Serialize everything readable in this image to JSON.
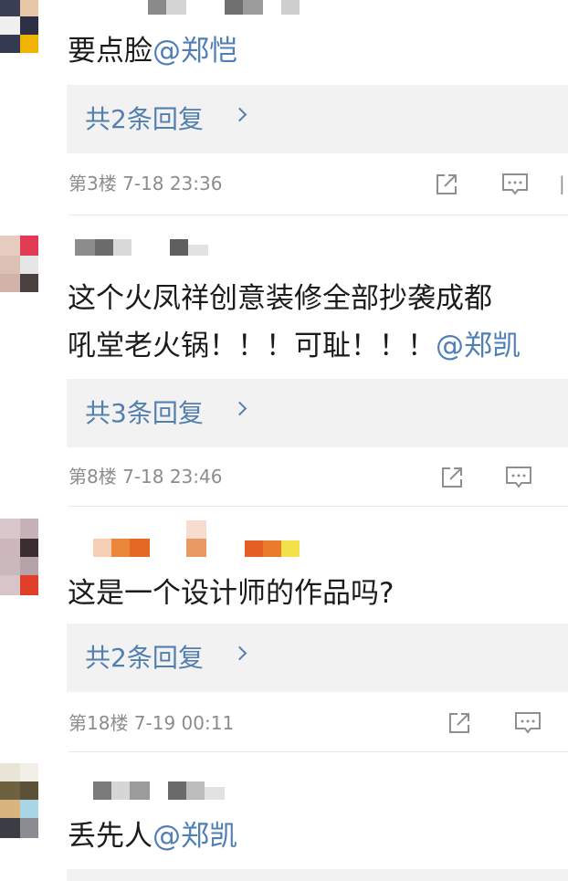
{
  "comments": [
    {
      "text": "要点脸",
      "mention": "@郑恺",
      "replies_label": "共2条回复",
      "floor_time": "第3楼 7-18 23:36"
    },
    {
      "text_line1": "这个火凤祥创意装修全部抄袭成都",
      "text_line2": "吼堂老火锅！！！可耻！！！",
      "mention": "@郑凯",
      "replies_label": "共3条回复",
      "floor_time": "第8楼 7-18 23:46"
    },
    {
      "text": "这是一个设计师的作品吗?",
      "replies_label": "共2条回复",
      "floor_time": "第18楼 7-19 00:11"
    },
    {
      "text": "丢先人",
      "mention": "@郑凯"
    }
  ],
  "icons": {
    "share": "share-icon",
    "reply": "comment-icon",
    "more": "chevron-right-icon"
  },
  "colors": {
    "mention": "#4f7fb6",
    "replies_link": "#527fae",
    "meta_text": "#8c8c8c",
    "reply_box_bg": "#f2f2f2"
  }
}
